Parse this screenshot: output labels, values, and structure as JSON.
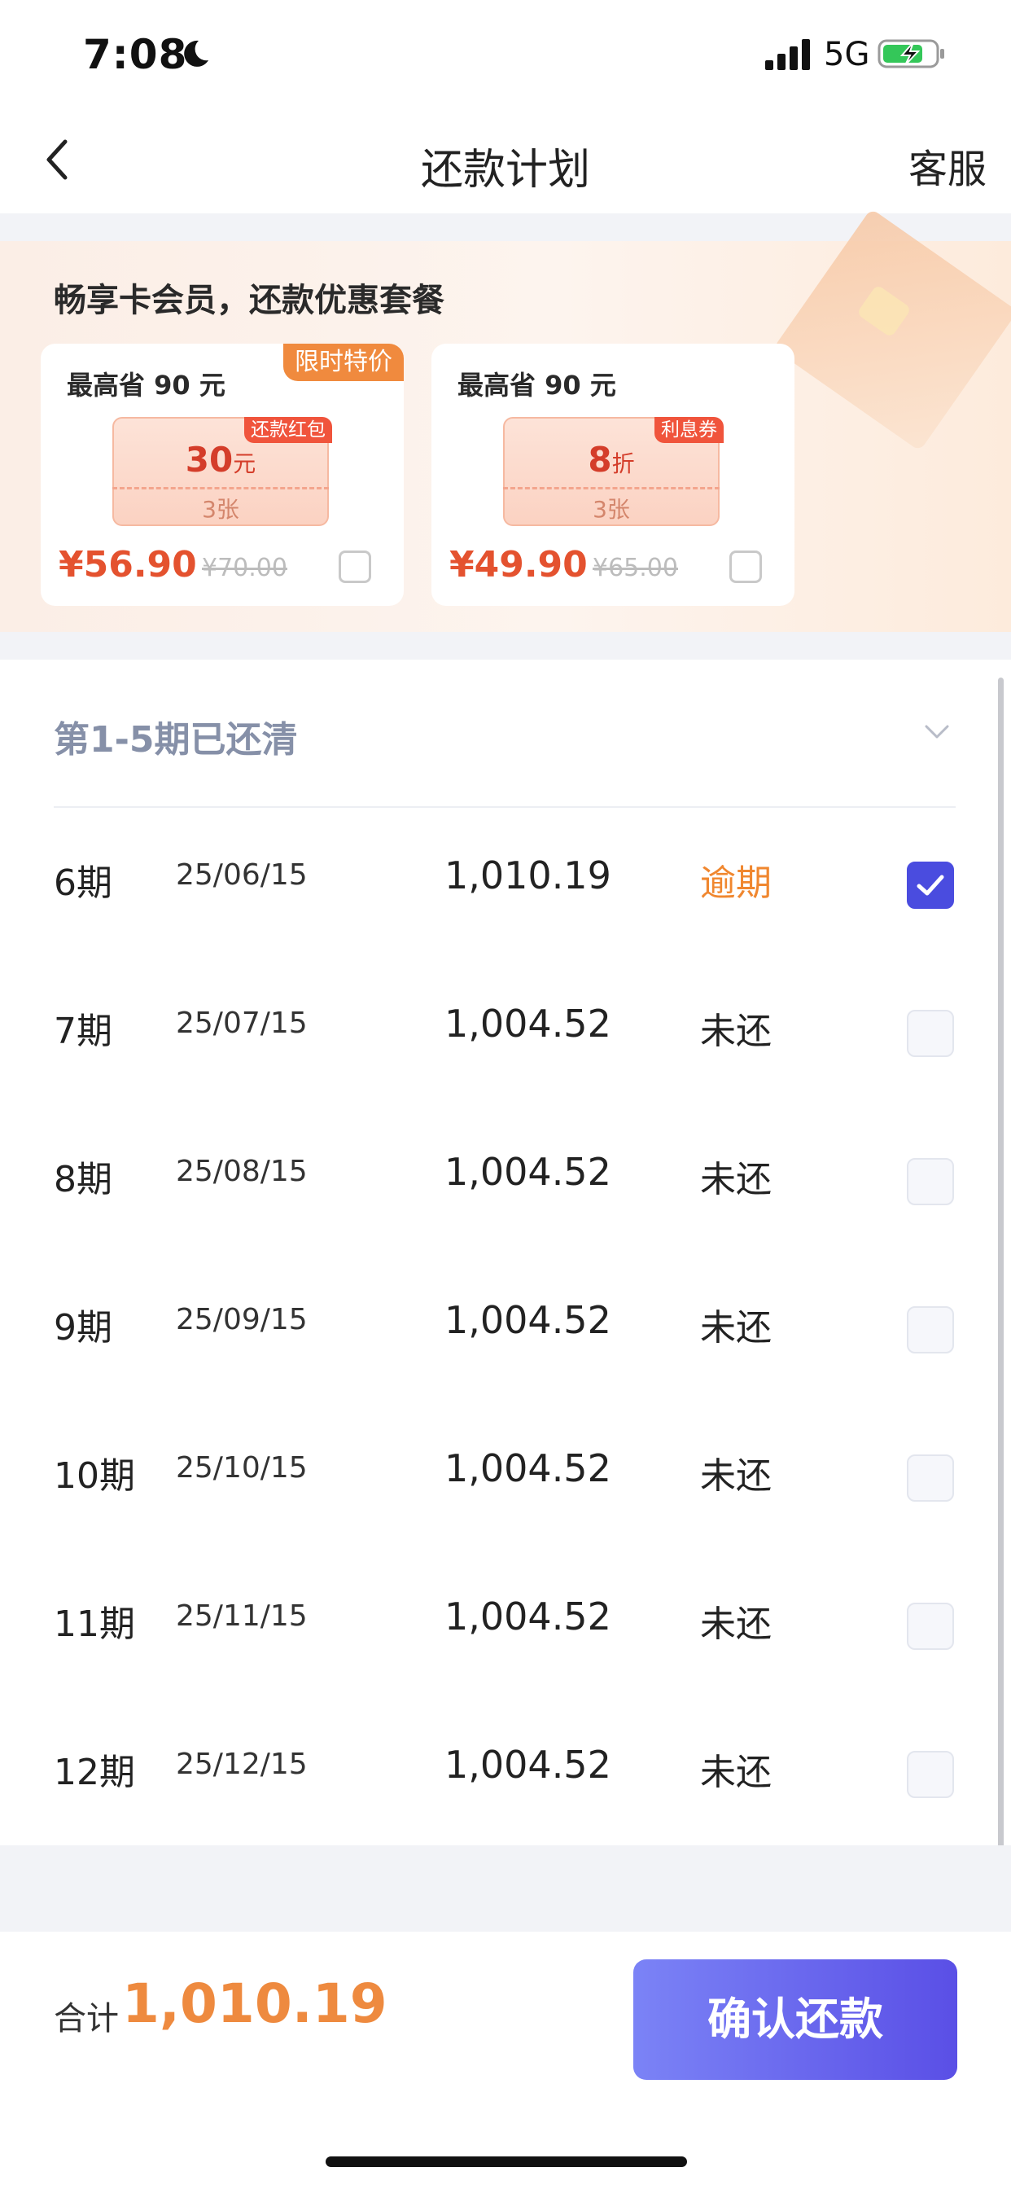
{
  "status_bar": {
    "time": "7:08",
    "network": "5G"
  },
  "nav": {
    "title": "还款计划",
    "service": "客服"
  },
  "banner": {
    "title": "畅享卡会员，还款优惠套餐",
    "cards": [
      {
        "save": "最高省 90 元",
        "ribbon": "限时特价",
        "tag": "还款红包",
        "value": "30",
        "unit": "元",
        "count": "3张",
        "price": "¥56.90",
        "old_price": "¥70.00",
        "checked": false
      },
      {
        "save": "最高省 90 元",
        "ribbon": "",
        "tag": "利息券",
        "value": "8",
        "unit": "折",
        "count": "3张",
        "price": "¥49.90",
        "old_price": "¥65.00",
        "checked": false
      }
    ]
  },
  "plan": {
    "paid_summary": "第1-5期已还清",
    "rows": [
      {
        "period": "6期",
        "date": "25/06/15",
        "amount": "1,010.19",
        "status": "逾期",
        "checked": true
      },
      {
        "period": "7期",
        "date": "25/07/15",
        "amount": "1,004.52",
        "status": "未还",
        "checked": false
      },
      {
        "period": "8期",
        "date": "25/08/15",
        "amount": "1,004.52",
        "status": "未还",
        "checked": false
      },
      {
        "period": "9期",
        "date": "25/09/15",
        "amount": "1,004.52",
        "status": "未还",
        "checked": false
      },
      {
        "period": "10期",
        "date": "25/10/15",
        "amount": "1,004.52",
        "status": "未还",
        "checked": false
      },
      {
        "period": "11期",
        "date": "25/11/15",
        "amount": "1,004.52",
        "status": "未还",
        "checked": false
      },
      {
        "period": "12期",
        "date": "25/12/15",
        "amount": "1,004.52",
        "status": "未还",
        "checked": false
      }
    ]
  },
  "footer": {
    "total_label": "合计",
    "total_value": "1,010.19",
    "confirm_label": "确认还款"
  },
  "colors": {
    "accent": "#5a4fe6",
    "overdue": "#f0872f",
    "price": "#e4522f"
  }
}
